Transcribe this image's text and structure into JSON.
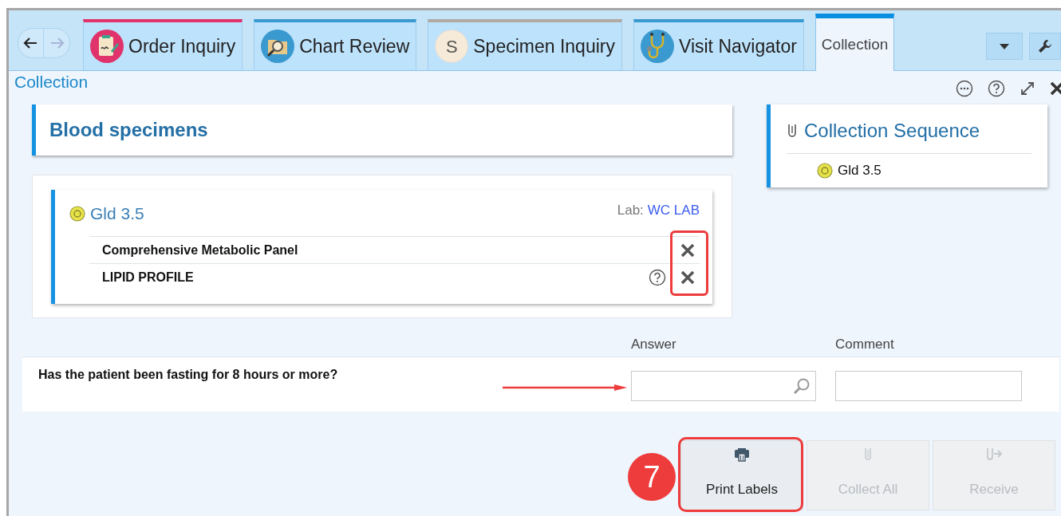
{
  "nav": {
    "back_enabled": true,
    "forward_enabled": false
  },
  "tabs": [
    {
      "label": "Order Inquiry",
      "kind": "order",
      "color": "#e0336b",
      "selected": false
    },
    {
      "label": "Chart Review",
      "kind": "chart",
      "color": "#3a9ad0",
      "selected": false
    },
    {
      "label": "Specimen Inquiry",
      "kind": "letter",
      "letter": "S",
      "color": "#b0aaa3",
      "selected": false
    },
    {
      "label": "Visit Navigator",
      "kind": "stethoscope",
      "color": "#3a9ad0",
      "selected": false
    },
    {
      "label": "Collection",
      "kind": "plain",
      "color": "#0a8ee0",
      "selected": true
    }
  ],
  "page_title": "Collection",
  "specimens": {
    "title": "Blood specimens",
    "container": {
      "name": "Gld 3.5",
      "lab_label": "Lab:",
      "lab": "WC LAB",
      "remove_highlighted": true,
      "orders": [
        {
          "name": "Comprehensive Metabolic Panel",
          "has_help": false
        },
        {
          "name": "LIPID PROFILE",
          "has_help": true
        }
      ]
    }
  },
  "sequence": {
    "title": "Collection Sequence",
    "items": [
      "Gld 3.5"
    ]
  },
  "questions": {
    "columns": [
      "Answer",
      "Comment"
    ],
    "rows": [
      {
        "question": "Has the patient been fasting for 8 hours or more?",
        "answer": "",
        "comment": "",
        "arrow": true
      }
    ]
  },
  "buttons": [
    {
      "label": "Print Labels",
      "kind": "print",
      "disabled": false,
      "highlighted": true,
      "badge": "7"
    },
    {
      "label": "Collect All",
      "kind": "collect",
      "disabled": true,
      "highlighted": false
    },
    {
      "label": "Receive",
      "kind": "receive",
      "disabled": true,
      "highlighted": false
    }
  ]
}
